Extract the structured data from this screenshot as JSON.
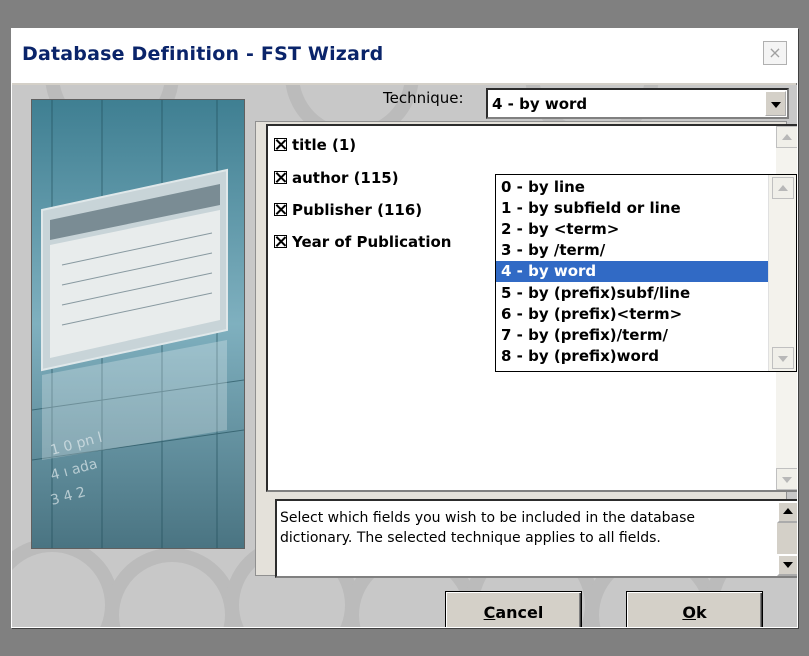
{
  "window": {
    "title": "Database Definition - FST Wizard",
    "close_glyph": "×"
  },
  "technique": {
    "label": "Technique:",
    "selected": "4 - by word",
    "options": [
      "0 - by line",
      "1 - by subfield or line",
      "2 - by <term>",
      "3 - by /term/",
      "4 - by word",
      "5 - by (prefix)subf/line",
      "6 - by (prefix)<term>",
      "7 - by (prefix)/term/",
      "8 - by (prefix)word"
    ],
    "selected_index": 4
  },
  "fields": [
    {
      "label": "title (1)",
      "checked": true
    },
    {
      "label": "author (115)",
      "checked": true
    },
    {
      "label": "Publisher (116)",
      "checked": true
    },
    {
      "label": "Year of Publication",
      "checked": true
    }
  ],
  "description": "Select which fields you wish to be included in the database dictionary. The selected technique applies to all fields.",
  "buttons": {
    "cancel_first": "C",
    "cancel_rest": "ancel",
    "ok_first": "O",
    "ok_rest": "k"
  },
  "colors": {
    "title_text": "#0a246a",
    "selection": "#316ac5",
    "dialog_face": "#d4d0c8"
  }
}
